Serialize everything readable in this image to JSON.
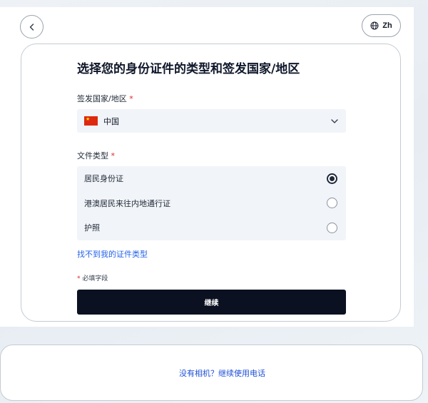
{
  "header": {
    "back_icon": "chevron-left-icon",
    "language_icon": "globe-icon",
    "language_label": "Zh"
  },
  "form": {
    "title": "选择您的身份证件的类型和签发国家/地区",
    "country_label": "签发国家/地区",
    "required_marker": "*",
    "country": {
      "flag_icon": "china-flag-icon",
      "selected": "中国"
    },
    "document_type_label": "文件类型",
    "document_types": [
      {
        "label": "居民身份证",
        "checked": true
      },
      {
        "label": "港澳居民来往内地通行证",
        "checked": false
      },
      {
        "label": "护照",
        "checked": false
      }
    ],
    "not_found_link": "找不到我的证件类型",
    "required_note_marker": "*",
    "required_note": "必填字段",
    "continue_label": "继续"
  },
  "footer": {
    "phone_link": "没有相机？继续使用电话"
  },
  "colors": {
    "accent_link": "#2563eb",
    "required": "#dc2626",
    "button_bg": "#0b1120"
  }
}
